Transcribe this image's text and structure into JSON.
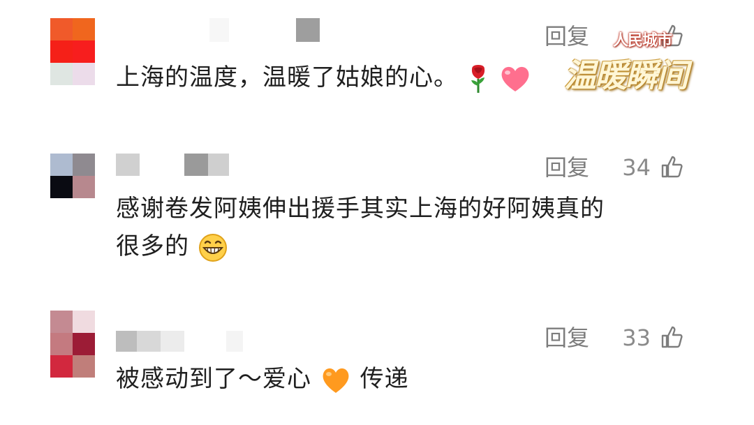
{
  "comments": [
    {
      "text": "上海的温度，温暖了姑娘的心。",
      "reply_label": "回复",
      "likes": "",
      "emojis": [
        "rose-icon",
        "pink-heart-icon"
      ]
    },
    {
      "text_line1": "感谢卷发阿姨伸出援手其实上海的好阿姨真的",
      "text_line2": "很多的",
      "reply_label": "回复",
      "likes": "34",
      "emojis": [
        "grinning-face-icon"
      ]
    },
    {
      "text_before": "被感动到了～爱心",
      "text_after": "传递",
      "reply_label": "回复",
      "likes": "33",
      "emojis": [
        "orange-heart-icon"
      ]
    }
  ],
  "watermark": {
    "line1": "人民城市",
    "line2": "温暖瞬间"
  },
  "colors": {
    "text": "#1f1f1f",
    "meta": "#7d7d7d",
    "watermark_gold": "#b8862a",
    "watermark_red": "#c03020"
  }
}
